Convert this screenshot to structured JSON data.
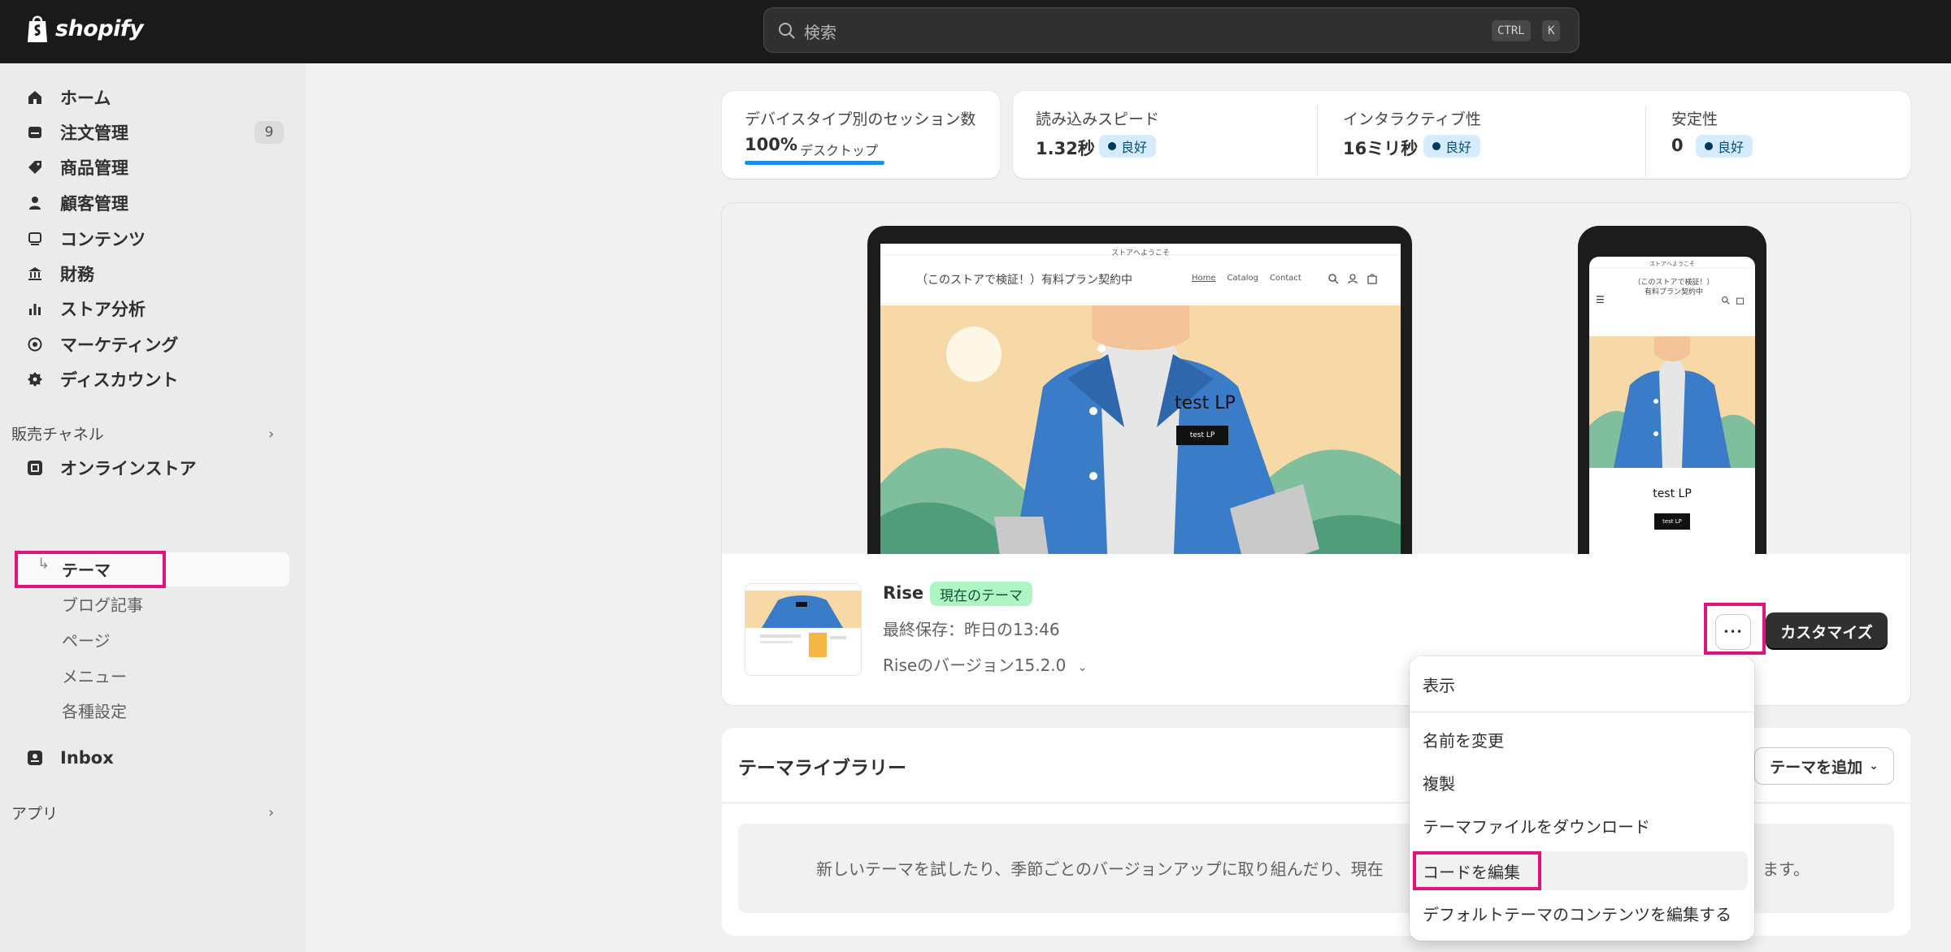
{
  "topbar": {
    "brand": "shopify",
    "search_placeholder": "検索",
    "shortcut_key1": "CTRL",
    "shortcut_key2": "K"
  },
  "sidebar": {
    "items": [
      {
        "label": "ホーム",
        "icon": "home-icon"
      },
      {
        "label": "注文管理",
        "icon": "orders-icon",
        "badge": "9"
      },
      {
        "label": "商品管理",
        "icon": "tag-icon"
      },
      {
        "label": "顧客管理",
        "icon": "person-icon"
      },
      {
        "label": "コンテンツ",
        "icon": "content-icon"
      },
      {
        "label": "財務",
        "icon": "bank-icon"
      },
      {
        "label": "ストア分析",
        "icon": "bar-chart-icon"
      },
      {
        "label": "マーケティング",
        "icon": "target-icon"
      },
      {
        "label": "ディスカウント",
        "icon": "discount-icon"
      }
    ],
    "sales_channels_title": "販売チャネル",
    "online_store": "オンラインストア",
    "sub_items": [
      "テーマ",
      "ブログ記事",
      "ページ",
      "メニュー",
      "各種設定"
    ],
    "inbox": "Inbox",
    "apps_title": "アプリ"
  },
  "metrics": {
    "sessions_label": "デバイスタイプ別のセッション数",
    "sessions_value": "100%",
    "sessions_device": "デスクトップ",
    "speed_label": "読み込みスピード",
    "speed_value": "1.32秒",
    "interactivity_label": "インタラクティブ性",
    "interactivity_value": "16ミリ秒",
    "stability_label": "安定性",
    "stability_value": "0",
    "good": "良好"
  },
  "preview": {
    "announcement": "ストアへようこそ",
    "store_name": "（このストアで検証！）有料プラン契約中",
    "nav": [
      "Home",
      "Catalog",
      "Contact"
    ],
    "mobile_store_name": "（このストアで検証！）有料プラン契約中",
    "hero_title": "test LP",
    "hero_button": "test LP"
  },
  "theme": {
    "name": "Rise",
    "status_badge": "現在のテーマ",
    "saved": "最終保存：昨日の13:46",
    "version": "Riseのバージョン15.2.0",
    "more": "•••",
    "customize": "カスタマイズ"
  },
  "library": {
    "title": "テーマライブラリー",
    "add_theme": "テーマを追加",
    "description_start": "新しいテーマを試したり、季節ごとのバージョンアップに取り組んだり、現在",
    "description_end": "ます。"
  },
  "menu": {
    "items": [
      "表示",
      "名前を変更",
      "複製",
      "テーマファイルをダウンロード",
      "コードを編集",
      "デフォルトテーマのコンテンツを編集する"
    ]
  },
  "colors": {
    "highlight": "#e0147f",
    "topbar": "#1a1a1a",
    "good_badge": "#d5ebff",
    "current_badge": "#aff5c4"
  }
}
